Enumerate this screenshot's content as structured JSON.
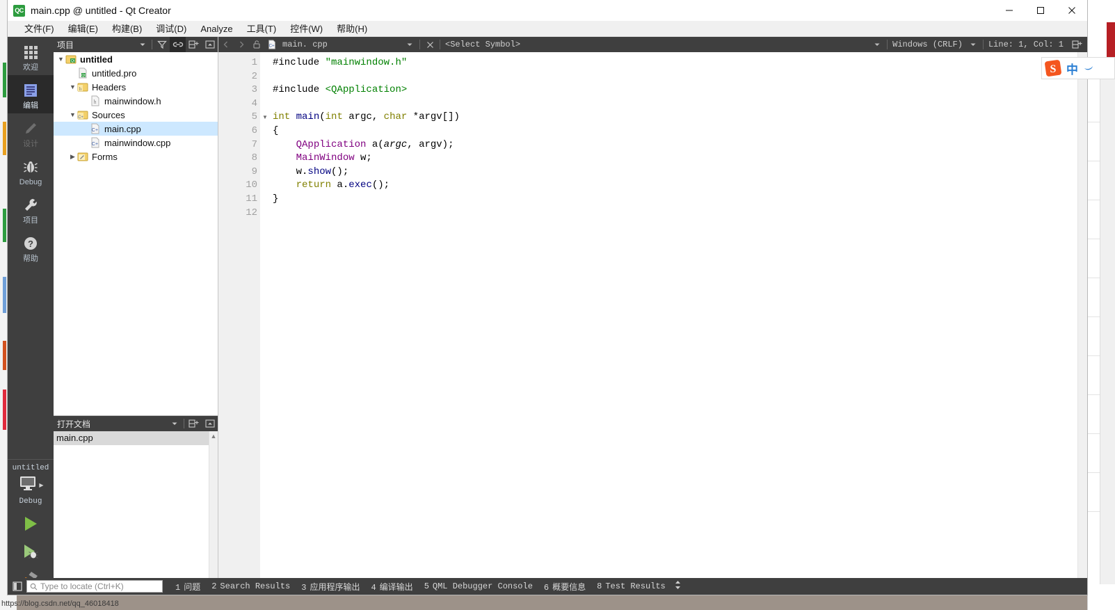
{
  "window": {
    "title": "main.cpp @ untitled - Qt Creator",
    "app_icon_text": "QC",
    "controls": {
      "minimize": "minimize-icon",
      "maximize": "maximize-icon",
      "close": "close-icon"
    }
  },
  "menubar": {
    "items": [
      {
        "label": "文件(F)",
        "mnemonic": "F"
      },
      {
        "label": "编辑(E)",
        "mnemonic": "E"
      },
      {
        "label": "构建(B)",
        "mnemonic": "B"
      },
      {
        "label": "调试(D)",
        "mnemonic": "D"
      },
      {
        "label": "Analyze",
        "mnemonic": "A"
      },
      {
        "label": "工具(T)",
        "mnemonic": "T"
      },
      {
        "label": "控件(W)",
        "mnemonic": "W"
      },
      {
        "label": "帮助(H)",
        "mnemonic": "H"
      }
    ]
  },
  "modebar": {
    "items": [
      {
        "label": "欢迎",
        "icon": "grid-icon",
        "state": "normal"
      },
      {
        "label": "编辑",
        "icon": "edit-lines-icon",
        "state": "active"
      },
      {
        "label": "设计",
        "icon": "pencil-icon",
        "state": "disabled"
      },
      {
        "label": "Debug",
        "icon": "bug-icon",
        "state": "normal"
      },
      {
        "label": "项目",
        "icon": "wrench-icon",
        "state": "normal"
      },
      {
        "label": "帮助",
        "icon": "question-circle-icon",
        "state": "normal"
      }
    ],
    "kit": {
      "project_name": "untitled",
      "build_config": "Debug",
      "target_icon": "desktop-monitor-icon",
      "expand_icon": "triangle-right-icon"
    },
    "actions": [
      {
        "name": "run-button",
        "icon": "play-green-icon"
      },
      {
        "name": "debug-button",
        "icon": "play-bug-icon"
      },
      {
        "name": "build-button",
        "icon": "hammer-icon"
      }
    ]
  },
  "project_panel": {
    "title": "项目",
    "tools": [
      {
        "name": "filter-dropdown",
        "icon": "chevron-down-icon"
      },
      {
        "name": "filter-tree-button",
        "icon": "funnel-icon"
      },
      {
        "name": "sync-selection-button",
        "icon": "link-icon",
        "pressed": true
      },
      {
        "name": "split-button",
        "icon": "split-plus-icon"
      },
      {
        "name": "close-panel-button",
        "icon": "minimize-panel-icon"
      }
    ],
    "tree": [
      {
        "indent": 0,
        "arrow": "down",
        "icon": "qt-project-icon",
        "label": "untitled",
        "bold": true,
        "selected": false
      },
      {
        "indent": 1,
        "arrow": "none",
        "icon": "qt-pro-file-icon",
        "label": "untitled.pro",
        "bold": false,
        "selected": false
      },
      {
        "indent": 1,
        "arrow": "down",
        "icon": "folder-h-icon",
        "label": "Headers",
        "bold": false,
        "selected": false
      },
      {
        "indent": 2,
        "arrow": "none",
        "icon": "header-file-icon",
        "label": "mainwindow.h",
        "bold": false,
        "selected": false
      },
      {
        "indent": 1,
        "arrow": "down",
        "icon": "folder-cpp-icon",
        "label": "Sources",
        "bold": false,
        "selected": false
      },
      {
        "indent": 2,
        "arrow": "none",
        "icon": "cpp-file-icon",
        "label": "main.cpp",
        "bold": false,
        "selected": true
      },
      {
        "indent": 2,
        "arrow": "none",
        "icon": "cpp-file-icon",
        "label": "mainwindow.cpp",
        "bold": false,
        "selected": false
      },
      {
        "indent": 1,
        "arrow": "right",
        "icon": "folder-forms-icon",
        "label": "Forms",
        "bold": false,
        "selected": false
      }
    ]
  },
  "open_documents": {
    "title": "打开文档",
    "tools": [
      {
        "name": "open-docs-dropdown",
        "icon": "chevron-down-icon"
      },
      {
        "name": "open-docs-split-button",
        "icon": "split-plus-icon"
      },
      {
        "name": "open-docs-close-button",
        "icon": "minimize-panel-icon"
      }
    ],
    "documents": [
      {
        "label": "main.cpp",
        "selected": true
      }
    ],
    "scroll": {
      "up_icon": "chevron-up-icon",
      "down_icon": "chevron-down-icon"
    }
  },
  "editor_toolbar": {
    "back_icon": "chevron-left-icon",
    "forward_icon": "chevron-right-icon",
    "lock_icon": "unlocked-padlock-icon",
    "file_icon": "cpp-file-icon",
    "filename": "main. cpp",
    "filename_dropdown_icon": "chevron-down-icon",
    "close_icon": "close-x-icon",
    "symbol_selector": "<Select Symbol>",
    "symbol_dropdown_icon": "chevron-down-icon",
    "line_ending": "Windows (CRLF)",
    "line_ending_dropdown_icon": "chevron-down-icon",
    "cursor_position": "Line: 1, Col: 1",
    "split_icon": "split-plus-icon"
  },
  "code": {
    "language": "cpp",
    "line_numbers": [
      "1",
      "2",
      "3",
      "4",
      "5",
      "6",
      "7",
      "8",
      "9",
      "10",
      "11",
      "12"
    ],
    "fold_marker_line": 5,
    "fold_marker_icon": "triangle-down-icon",
    "lines": [
      [
        {
          "t": "#include ",
          "c": "pre"
        },
        {
          "t": "\"mainwindow.h\"",
          "c": "str"
        }
      ],
      [],
      [
        {
          "t": "#include ",
          "c": "pre"
        },
        {
          "t": "<QApplication>",
          "c": "str"
        }
      ],
      [],
      [
        {
          "t": "int",
          "c": "kw"
        },
        {
          "t": " ",
          "c": "plain"
        },
        {
          "t": "main",
          "c": "fn"
        },
        {
          "t": "(",
          "c": "plain"
        },
        {
          "t": "int",
          "c": "kw"
        },
        {
          "t": " argc, ",
          "c": "plain"
        },
        {
          "t": "char",
          "c": "kw"
        },
        {
          "t": " *argv[])",
          "c": "plain"
        }
      ],
      [
        {
          "t": "{",
          "c": "plain"
        }
      ],
      [
        {
          "t": "    ",
          "c": "plain"
        },
        {
          "t": "QApplication",
          "c": "type"
        },
        {
          "t": " a(",
          "c": "plain"
        },
        {
          "t": "argc",
          "c": "param"
        },
        {
          "t": ", argv);",
          "c": "plain"
        }
      ],
      [
        {
          "t": "    ",
          "c": "plain"
        },
        {
          "t": "MainWindow",
          "c": "type"
        },
        {
          "t": " w;",
          "c": "plain"
        }
      ],
      [
        {
          "t": "    w.",
          "c": "plain"
        },
        {
          "t": "show",
          "c": "fn"
        },
        {
          "t": "();",
          "c": "plain"
        }
      ],
      [
        {
          "t": "    ",
          "c": "plain"
        },
        {
          "t": "return",
          "c": "kw"
        },
        {
          "t": " a.",
          "c": "plain"
        },
        {
          "t": "exec",
          "c": "fn"
        },
        {
          "t": "();",
          "c": "plain"
        }
      ],
      [
        {
          "t": "}",
          "c": "plain"
        }
      ],
      []
    ]
  },
  "statusbar": {
    "toggle_sidebar_icon": "sidebar-toggle-icon",
    "locator_icon": "search-icon",
    "locator_placeholder": "Type to locate (Ctrl+K)",
    "locator_value": "",
    "panes": [
      {
        "number": "1",
        "label": "问题"
      },
      {
        "number": "2",
        "label": "Search Results"
      },
      {
        "number": "3",
        "label": "应用程序输出"
      },
      {
        "number": "4",
        "label": "编译输出"
      },
      {
        "number": "5",
        "label": "QML Debugger Console"
      },
      {
        "number": "6",
        "label": "概要信息"
      },
      {
        "number": "8",
        "label": "Test Results"
      }
    ],
    "updown_icon": "up-down-arrows-icon"
  },
  "ime": {
    "name": "sogou-ime",
    "logo": "sogou-s-logo",
    "mode_label": "中",
    "extra_icon": "crescent-icon"
  },
  "watermark": {
    "text": "https://blog.csdn.net/qq_46018418"
  },
  "colors": {
    "dark_chrome": "#3f3f3f",
    "mode_active": "#2a2a2a",
    "tree_selection": "#cde8ff",
    "doc_selection": "#d9d9d9",
    "accent_green": "#2d9c3f",
    "string_green": "#008000",
    "keyword_olive": "#808000",
    "type_purple": "#800080",
    "function_navy": "#000080",
    "gutter_bg": "#f0f0f0"
  }
}
